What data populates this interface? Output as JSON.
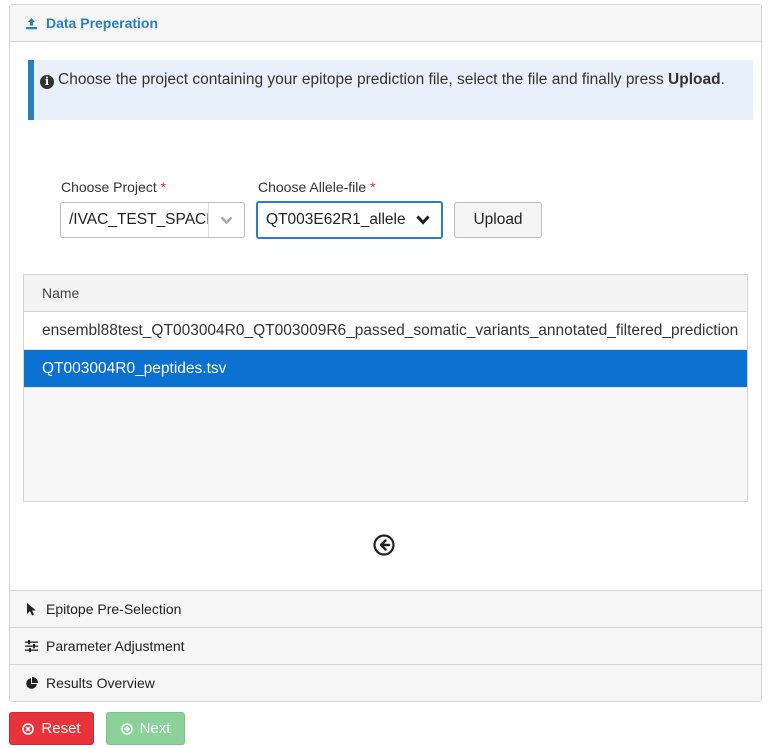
{
  "accordion": {
    "data_prep": {
      "title": "Data Preperation",
      "icon": "upload-icon"
    },
    "epitope": {
      "title": "Epitope Pre-Selection",
      "icon": "cursor-icon"
    },
    "params": {
      "title": "Parameter Adjustment",
      "icon": "sliders-icon"
    },
    "results": {
      "title": "Results Overview",
      "icon": "pie-chart-icon"
    }
  },
  "info": {
    "text": "Choose the project containing your epitope prediction file, select the file and finally press ",
    "bold": "Upload",
    "end": "."
  },
  "project": {
    "label": "Choose Project",
    "required": "*",
    "value": "/IVAC_TEST_SPACE"
  },
  "allele": {
    "label": "Choose Allele-file",
    "required": "*",
    "value": "QT003E62R1_allele"
  },
  "upload_label": "Upload",
  "table": {
    "header": "Name",
    "rows": [
      "ensembl88test_QT003004R0_QT003009R6_passed_somatic_variants_annotated_filtered_prediction",
      "QT003004R0_peptides.tsv"
    ],
    "selected_index": 1
  },
  "buttons": {
    "reset": "Reset",
    "next": "Next"
  },
  "colors": {
    "accent": "#2a7fc1",
    "selected_row": "#0a71d0",
    "reset": "#e8333b",
    "next": "#8cd19a"
  }
}
